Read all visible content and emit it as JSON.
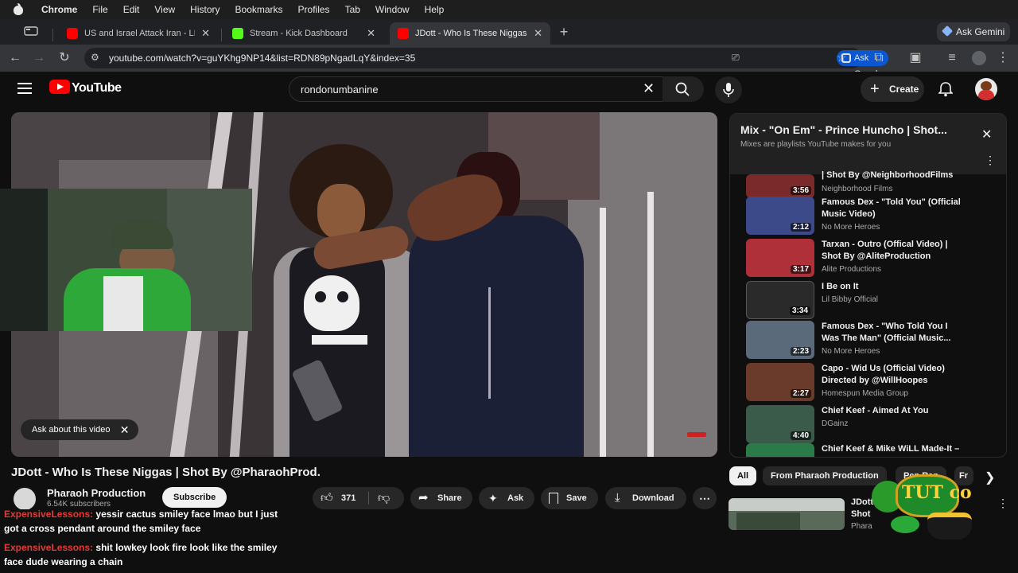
{
  "menubar": {
    "app": "Chrome",
    "items": [
      "File",
      "Edit",
      "View",
      "History",
      "Bookmarks",
      "Profiles",
      "Tab",
      "Window",
      "Help"
    ]
  },
  "tabs": [
    {
      "title": "US and Israel Attack Iran - LIVE",
      "favicon_color": "#ff0000"
    },
    {
      "title": "Stream - Kick Dashboard",
      "favicon_color": "#53fc18"
    },
    {
      "title": "JDott - Who Is These Niggas | Shot By",
      "favicon_color": "#ff0000"
    }
  ],
  "ask_gemini": "Ask Gemini",
  "address": {
    "url": "youtube.com/watch?v=guYKhg9NP14&list=RDN89pNgadLqY&index=35",
    "ask_google": "Ask Google"
  },
  "youtube": {
    "logo": "YouTube",
    "search_value": "rondonumbanine",
    "create_label": "Create"
  },
  "video": {
    "ask_label": "Ask about this video",
    "title": "JDott - Who Is These Niggas | Shot By @PharaohProd.",
    "channel": "Pharaoh Production",
    "subscribers": "6.54K subscribers",
    "subscribe_label": "Subscribe",
    "likes": "371",
    "share_label": "Share",
    "ask_label_btn": "Ask",
    "save_label": "Save",
    "download_label": "Download"
  },
  "chat": [
    {
      "user": "ExpensiveLessons:",
      "line1": "yessir cactus smiley face lmao but I just",
      "line2": "got a cross pendant around the smiley face"
    },
    {
      "user": "ExpensiveLessons:",
      "line1": "shit lowkey look fire look like the smiley",
      "line2": "face dude wearing a chain"
    }
  ],
  "mix": {
    "title": "Mix - \"On Em\" - Prince Huncho | Shot...",
    "subtitle": "Mixes are playlists YouTube makes for you",
    "items": [
      {
        "title1": "| Shot By @NeighborhoodFilms",
        "title2": "",
        "channel": "Neighborhood Films",
        "duration": "3:56",
        "thumb_color": "#7a2a2a"
      },
      {
        "title1": "Famous Dex - \"Told You\" (Official",
        "title2": "Music Video)",
        "channel": "No More Heroes",
        "duration": "2:12",
        "thumb_color": "#3d4a8a"
      },
      {
        "title1": "Tarxan - Outro (Offical Video) |",
        "title2": "Shot By @AliteProduction",
        "channel": "Alite Productions",
        "duration": "3:17",
        "thumb_color": "#b0303a"
      },
      {
        "title1": "I Be on It",
        "title2": "",
        "channel": "Lil Bibby Official",
        "duration": "3:34",
        "thumb_color": "#2a2a2a"
      },
      {
        "title1": "Famous Dex - \"Who Told You I",
        "title2": "Was The Man\" (Official Music...",
        "channel": "No More Heroes",
        "duration": "2:23",
        "thumb_color": "#5a6a7a"
      },
      {
        "title1": "Capo - Wid Us (Official Video)",
        "title2": "Directed by @WillHoopes",
        "channel": "Homespun Media Group",
        "duration": "2:27",
        "thumb_color": "#6a3a2a"
      },
      {
        "title1": "Chief Keef - Aimed At You",
        "title2": "",
        "channel": "DGainz",
        "duration": "4:40",
        "thumb_color": "#3a5a4a"
      },
      {
        "title1": "Chief Keef & Mike WiLL Made-It –",
        "title2": "",
        "channel": "",
        "duration": "",
        "thumb_color": "#2a7a4a"
      }
    ]
  },
  "chips": [
    "All",
    "From Pharaoh Production",
    "Pen Rap",
    "Fr"
  ],
  "related": {
    "title1": "JDott",
    "title2": "Shot",
    "channel": "Phara"
  },
  "logo_overlay": "TUT co"
}
